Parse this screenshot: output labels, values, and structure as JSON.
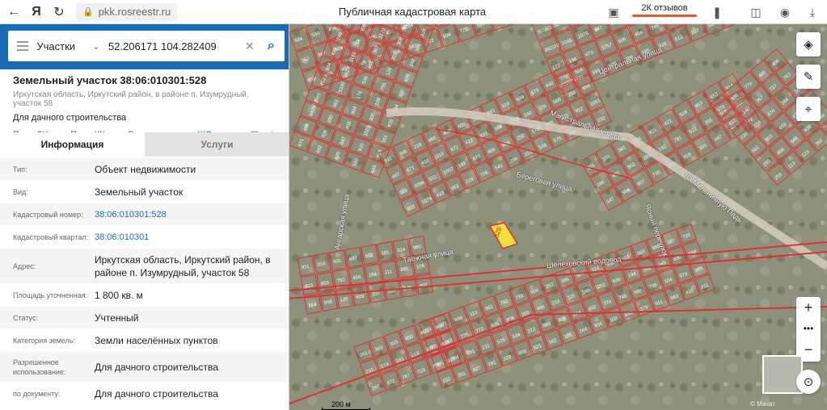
{
  "browser": {
    "url": "pkk.rosreestr.ru",
    "page_title": "Публичная кадастровая карта",
    "reviews": "2К отзывов"
  },
  "search": {
    "type": "Участки",
    "query": "52.206171 104.282409"
  },
  "parcel": {
    "title": "Земельный участок 38:06:010301:528",
    "address_small": "Иркутская область, Иркутский район, в районе п. Изумрудный, участок 58",
    "purpose": "Для дачного строительства",
    "links": [
      "План ЗУ →",
      "План КК →",
      "Создать участок ЖС →"
    ]
  },
  "tabs": [
    "Информация",
    "Услуги"
  ],
  "info": [
    {
      "label": "Тип:",
      "value": "Объект недвижимости"
    },
    {
      "label": "Вид:",
      "value": "Земельный участок"
    },
    {
      "label": "Кадастровый номер:",
      "value": "38:06:010301:528"
    },
    {
      "label": "Кадастровый квартал:",
      "value": "38:06:010301"
    },
    {
      "label": "Адрес:",
      "value": "Иркутская область, Иркутский район, в районе п. Изумрудный, участок 58"
    },
    {
      "label": "Площадь уточненная:",
      "value": "1 800 кв. м"
    },
    {
      "label": "Статус:",
      "value": "Учтенный"
    },
    {
      "label": "Категория земель:",
      "value": "Земли населённых пунктов"
    },
    {
      "label": "Разрешенное использование:",
      "value": "Для дачного строительства"
    },
    {
      "label": "по документу:",
      "value": "Для дачного строительства"
    }
  ],
  "map": {
    "streets": [
      "Магистральная улица",
      "Береговая улица",
      "Таежная улица",
      "Шелеховский водовод",
      "Центральная улица",
      "на Мельничную Падь",
      "Ангарская улица",
      "Ясный переулок"
    ],
    "parcel_labels": [
      "528",
      "533",
      "9285",
      "9284",
      "822",
      "1786",
      "526",
      "9158/2",
      "8622/2",
      "104Б",
      "107Б",
      "1/2",
      "586",
      "1757",
      "1737",
      "9158/22",
      "6439/11",
      "9349/1",
      "1020",
      "1191",
      "1170",
      "1003",
      "1023",
      "584",
      "671",
      "672",
      "1169",
      "1096",
      "1057",
      "677",
      "1765",
      "1081",
      "1074",
      "543",
      "522"
    ],
    "scale": "200 м",
    "attribution": "© Махат",
    "highlight_color": "#f0e040",
    "boundary_color": "#e03030"
  }
}
